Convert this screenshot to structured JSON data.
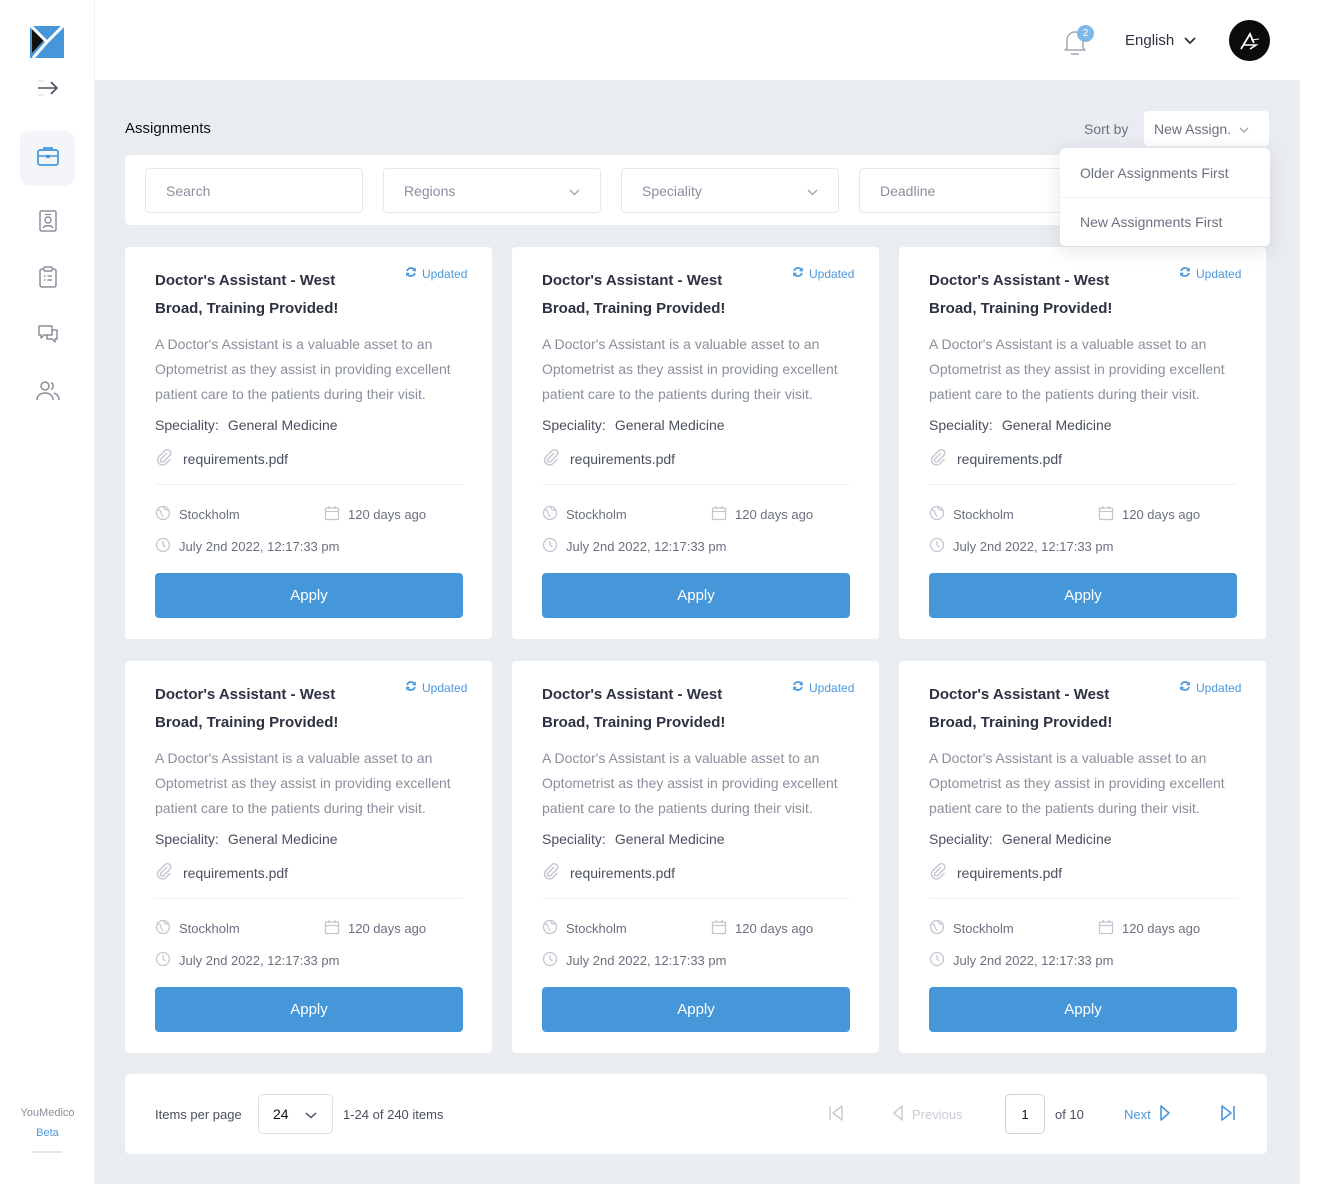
{
  "app": {
    "brand_name": "YouMedico",
    "brand_tag": "Beta",
    "accent_color": "#4597da"
  },
  "sidebar": {
    "items": [
      {
        "id": "assignments",
        "icon": "briefcase-icon",
        "active": true
      },
      {
        "id": "profile",
        "icon": "id-badge-icon",
        "active": false
      },
      {
        "id": "clipboard",
        "icon": "clipboard-list-icon",
        "active": false
      },
      {
        "id": "messages",
        "icon": "chat-icon",
        "active": false
      },
      {
        "id": "users",
        "icon": "users-icon",
        "active": false
      }
    ]
  },
  "header": {
    "notification_count": "2",
    "language": "English"
  },
  "page": {
    "title": "Assignments",
    "sort": {
      "label": "Sort by",
      "selected": "New Assign.",
      "options": [
        "Older Assignments First",
        "New Assignments First"
      ]
    },
    "filters": {
      "search_placeholder": "Search",
      "regions": "Regions",
      "speciality": "Speciality",
      "deadline": "Deadline"
    }
  },
  "cards": [
    {
      "title": "Doctor's Assistant - West Broad, Training Provided!",
      "badge": "Updated",
      "description": "A Doctor's Assistant is a valuable asset to an Optometrist as they assist in providing excellent patient care to the patients during their visit.",
      "speciality_label": "Speciality:",
      "speciality": "General Medicine",
      "file": "requirements.pdf",
      "location": "Stockholm",
      "age": "120 days ago",
      "date": "July 2nd 2022, 12:17:33 pm",
      "apply": "Apply"
    },
    {
      "title": "Doctor's Assistant - West Broad, Training Provided!",
      "badge": "Updated",
      "description": "A Doctor's Assistant is a valuable asset to an Optometrist as they assist in providing excellent patient care to the patients during their visit.",
      "speciality_label": "Speciality:",
      "speciality": "General Medicine",
      "file": "requirements.pdf",
      "location": "Stockholm",
      "age": "120 days ago",
      "date": "July 2nd 2022, 12:17:33 pm",
      "apply": "Apply"
    },
    {
      "title": "Doctor's Assistant - West Broad, Training Provided!",
      "badge": "Updated",
      "description": "A Doctor's Assistant is a valuable asset to an Optometrist as they assist in providing excellent patient care to the patients during their visit.",
      "speciality_label": "Speciality:",
      "speciality": "General Medicine",
      "file": "requirements.pdf",
      "location": "Stockholm",
      "age": "120 days ago",
      "date": "July 2nd 2022, 12:17:33 pm",
      "apply": "Apply"
    },
    {
      "title": "Doctor's Assistant - West Broad, Training Provided!",
      "badge": "Updated",
      "description": "A Doctor's Assistant is a valuable asset to an Optometrist as they assist in providing excellent patient care to the patients during their visit.",
      "speciality_label": "Speciality:",
      "speciality": "General Medicine",
      "file": "requirements.pdf",
      "location": "Stockholm",
      "age": "120 days ago",
      "date": "July 2nd 2022, 12:17:33 pm",
      "apply": "Apply"
    },
    {
      "title": "Doctor's Assistant - West Broad, Training Provided!",
      "badge": "Updated",
      "description": "A Doctor's Assistant is a valuable asset to an Optometrist as they assist in providing excellent patient care to the patients during their visit.",
      "speciality_label": "Speciality:",
      "speciality": "General Medicine",
      "file": "requirements.pdf",
      "location": "Stockholm",
      "age": "120 days ago",
      "date": "July 2nd 2022, 12:17:33 pm",
      "apply": "Apply"
    },
    {
      "title": "Doctor's Assistant - West Broad, Training Provided!",
      "badge": "Updated",
      "description": "A Doctor's Assistant is a valuable asset to an Optometrist as they assist in providing excellent patient care to the patients during their visit.",
      "speciality_label": "Speciality:",
      "speciality": "General Medicine",
      "file": "requirements.pdf",
      "location": "Stockholm",
      "age": "120 days ago",
      "date": "July 2nd 2022, 12:17:33 pm",
      "apply": "Apply"
    }
  ],
  "pagination": {
    "items_per_page_label": "Items per page",
    "items_per_page": "24",
    "range": "1-24 of 240 items",
    "previous": "Previous",
    "current_page": "1",
    "of_pages": "of 10",
    "next": "Next"
  }
}
